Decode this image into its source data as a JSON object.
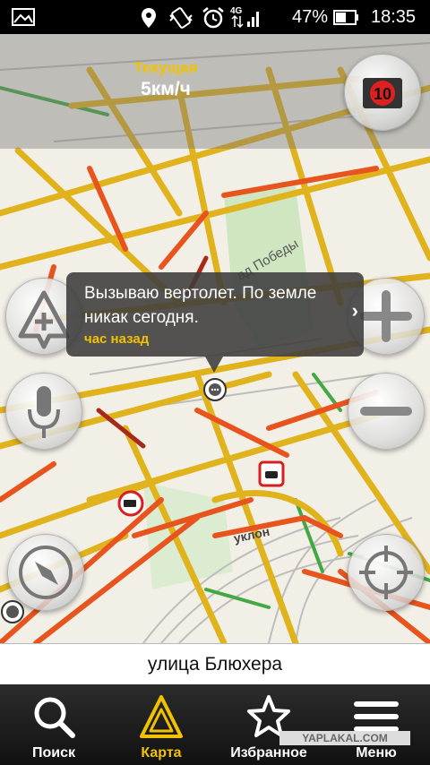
{
  "status_bar": {
    "battery_percent": "47%",
    "time": "18:35",
    "network": "4G",
    "icons": [
      "image-icon",
      "location-pin-icon",
      "vibrate-icon",
      "alarm-icon",
      "signal-4g-icon",
      "battery-icon"
    ]
  },
  "speed": {
    "label": "Текущая",
    "value": "5км/ч"
  },
  "traffic_score": {
    "value": "10",
    "color": "#e02020"
  },
  "map": {
    "park_label": "ад Победы",
    "road_label": "уклон"
  },
  "event_bubble": {
    "text": "Вызываю вертолет. По земле никак сегодня.",
    "time": "час назад",
    "chevron": "›"
  },
  "controls": {
    "zoom_in": "plus-icon",
    "zoom_out": "minus-icon",
    "add_event": "add-event-icon",
    "voice": "microphone-icon",
    "compass": "compass-icon",
    "locate": "crosshair-icon"
  },
  "street": {
    "name": "улица Блюхера"
  },
  "bottom_nav": {
    "items": [
      {
        "label": "Поиск",
        "icon": "search-icon"
      },
      {
        "label": "Карта",
        "icon": "map-arrow-icon"
      },
      {
        "label": "Избранное",
        "icon": "star-icon"
      },
      {
        "label": "Меню",
        "icon": "menu-icon"
      }
    ],
    "active_color": "#f2c200"
  },
  "watermark": "YAPLAKAL.COM"
}
